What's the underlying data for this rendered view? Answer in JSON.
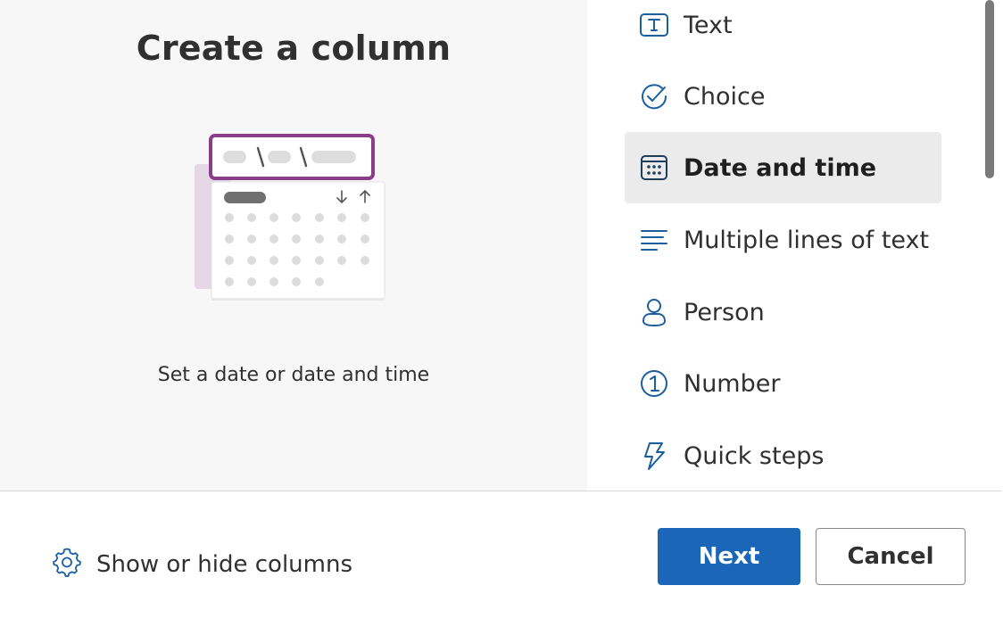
{
  "left_panel": {
    "title": "Create a column",
    "description": "Set a date or date and time"
  },
  "column_types": [
    {
      "label": "Text",
      "icon": "text-icon",
      "selected": false
    },
    {
      "label": "Choice",
      "icon": "choice-check-icon",
      "selected": false
    },
    {
      "label": "Date and time",
      "icon": "calendar-icon",
      "selected": true
    },
    {
      "label": "Multiple lines of text",
      "icon": "multiline-text-icon",
      "selected": false
    },
    {
      "label": "Person",
      "icon": "person-icon",
      "selected": false
    },
    {
      "label": "Number",
      "icon": "number-icon",
      "selected": false
    },
    {
      "label": "Quick steps",
      "icon": "lightning-icon",
      "selected": false
    }
  ],
  "footer": {
    "show_hide_label": "Show or hide columns",
    "next_label": "Next",
    "cancel_label": "Cancel"
  },
  "colors": {
    "accent": "#1b66b8",
    "illustration_border": "#8a3d8a",
    "icon_blue": "#1b5f9e"
  }
}
